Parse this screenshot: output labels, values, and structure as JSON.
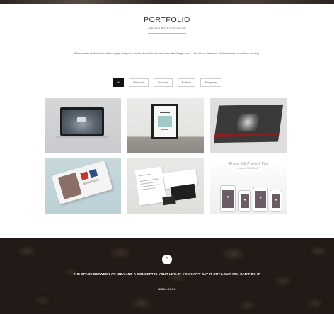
{
  "header": {
    "title": "PORTFOLIO",
    "subtitle": "SEE OUR BEST WORKS FOR"
  },
  "intro": "If the reader realizes the inferior page design of a book, it won't have the three vital things: one — fine blood, freedom, distinctiveness from their reading.",
  "filters": [
    {
      "label": "All",
      "active": true
    },
    {
      "label": "Windows",
      "active": false
    },
    {
      "label": "Devices",
      "active": false
    },
    {
      "label": "Posters",
      "active": false
    },
    {
      "label": "Templates",
      "active": false
    }
  ],
  "portfolio_items": [
    {
      "image": "laptop-mockup"
    },
    {
      "image": "framed-poster-mockup"
    },
    {
      "image": "dark-city-print-mockup"
    },
    {
      "image": "phone-brochure-mockup"
    },
    {
      "image": "stationery-mockup"
    },
    {
      "image": "iphone-mockup",
      "caption": "iPhone 6 & iPhone 6 Plus",
      "caption_sub": "Vector MOCKUP"
    }
  ],
  "quote": {
    "icon": "quote-icon",
    "icon_glyph": "”",
    "text": "THE SPACE BETWEEN AN IDEA AND A CONCEPT IS YOUR LIFE. IF YOU CAN'T SAY IT OUT LOUD YOU CAN'T DO IT.",
    "author": "NICKLONSO"
  },
  "colors": {
    "active_filter": "#121212",
    "quote_background": "#2c241f"
  }
}
